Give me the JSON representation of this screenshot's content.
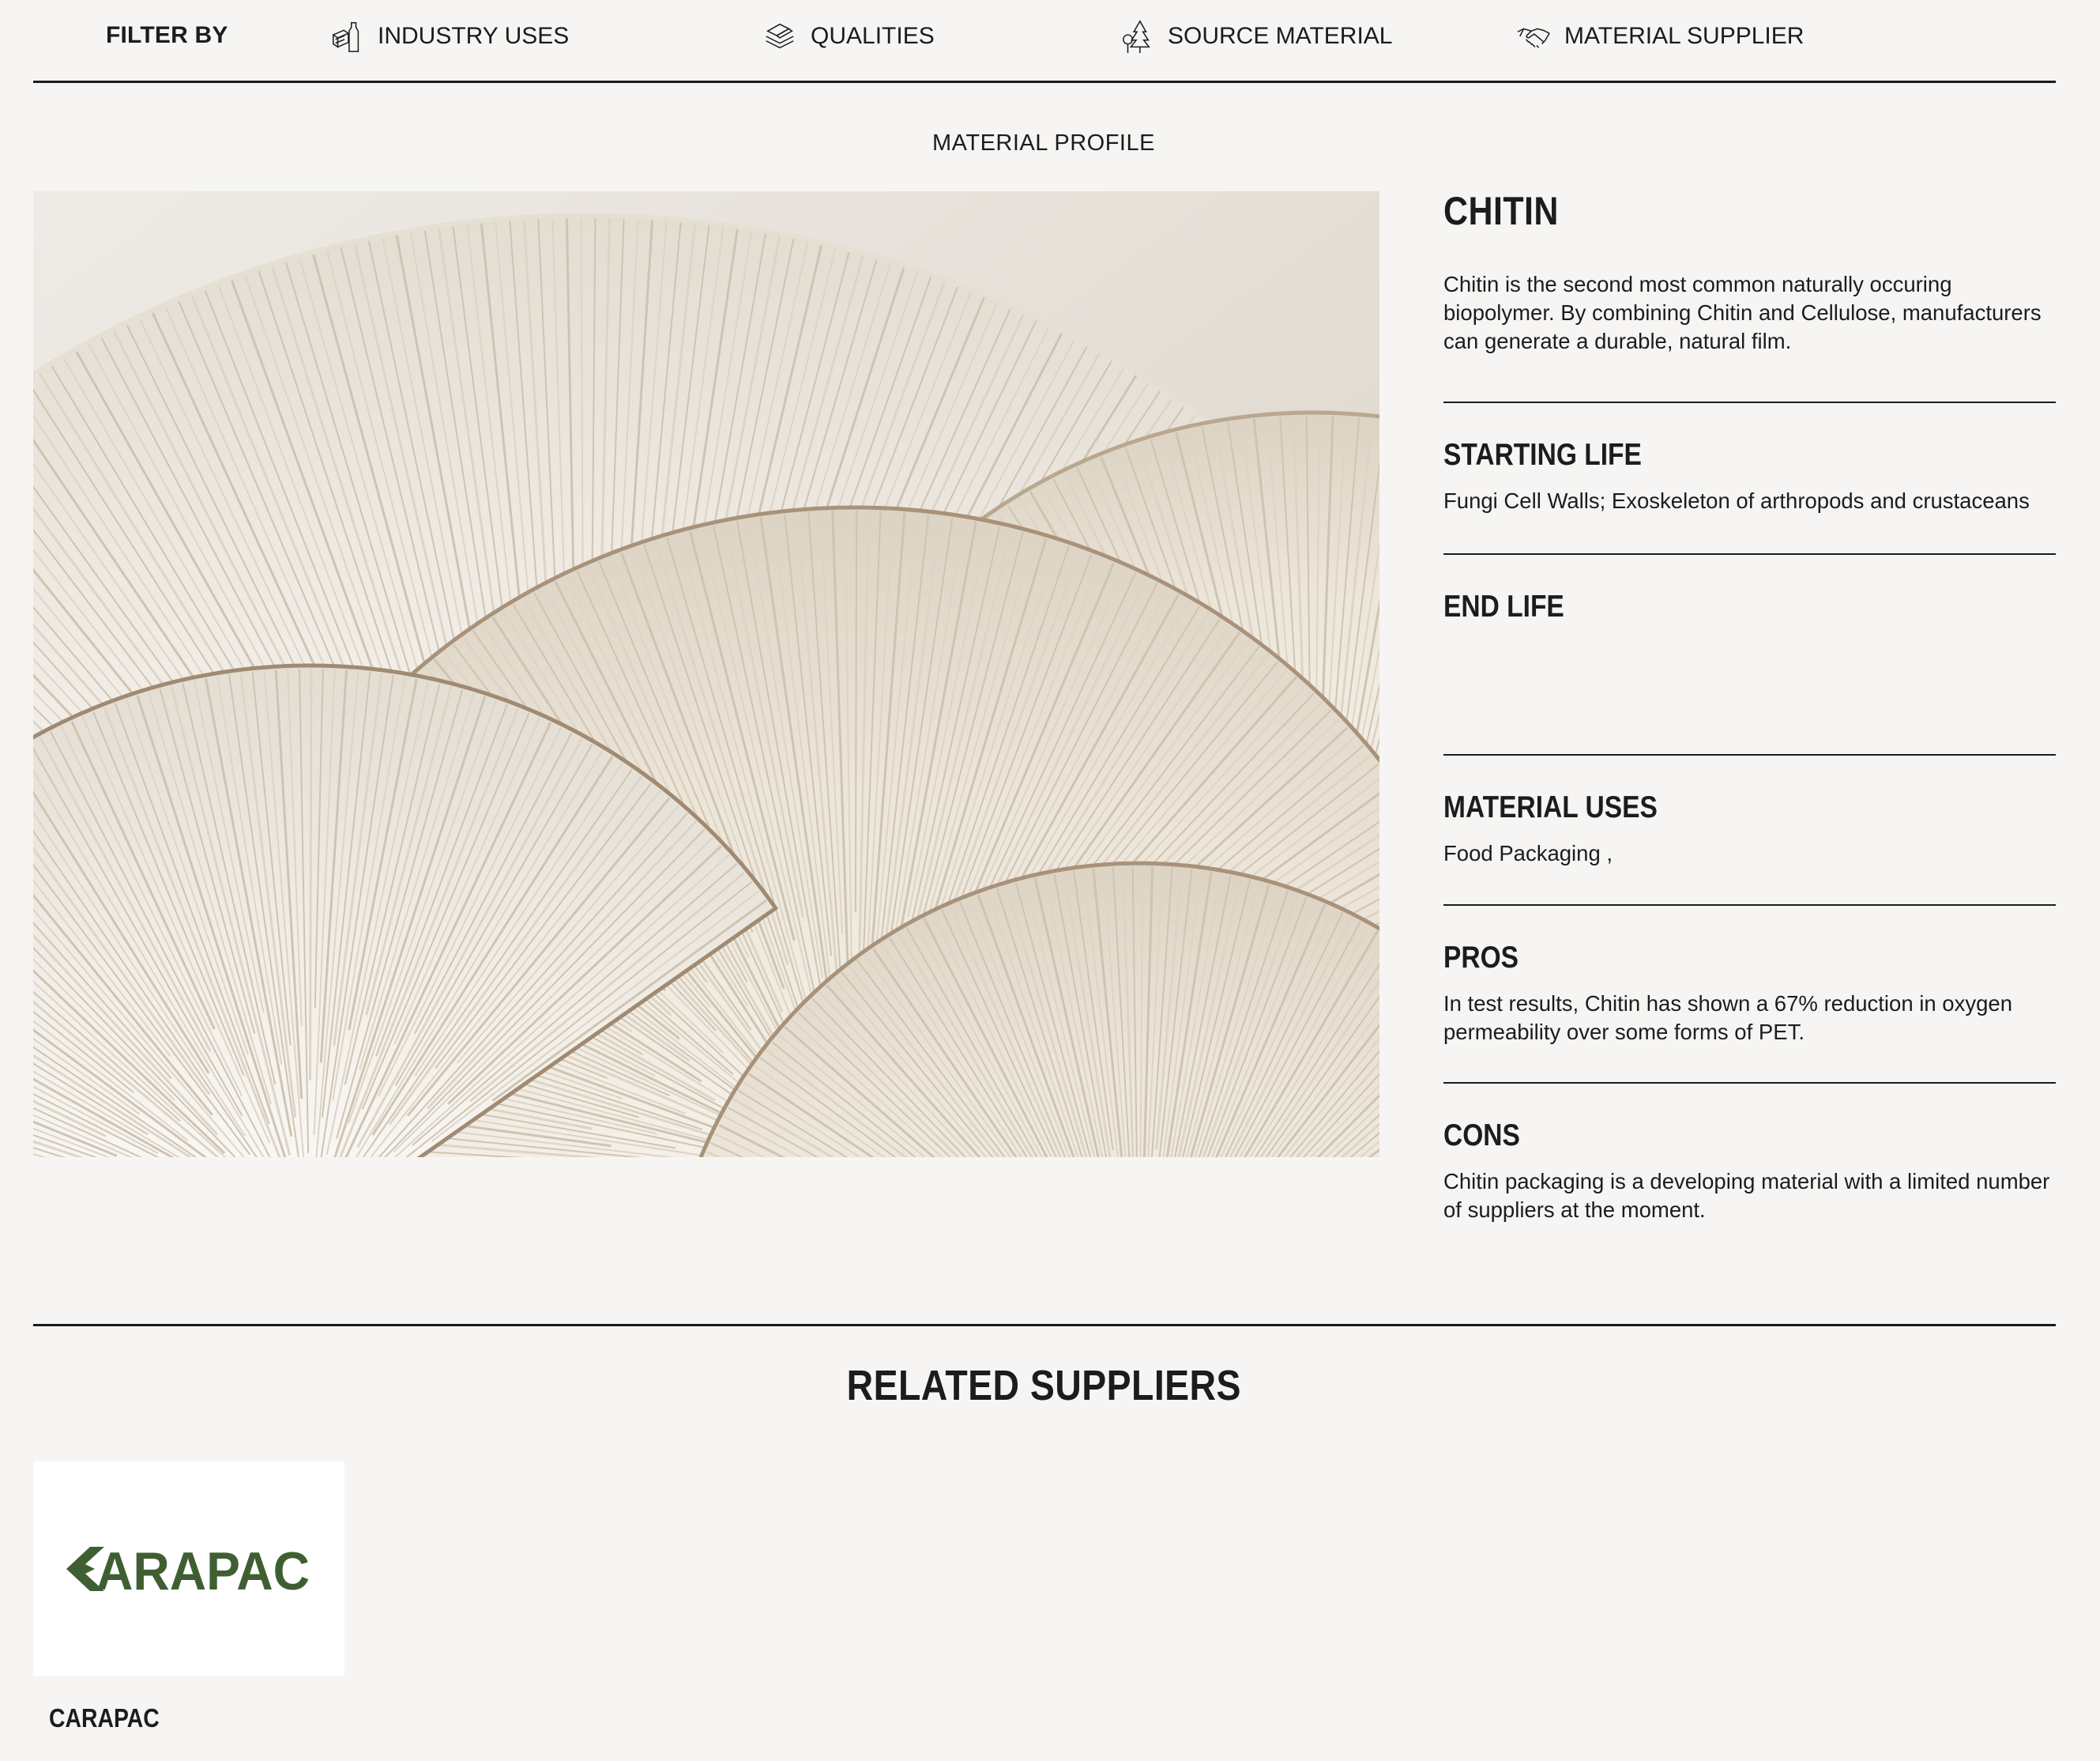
{
  "filter_bar": {
    "label": "FILTER BY",
    "items": [
      {
        "label": "INDUSTRY USES",
        "icon": "bottles-icon"
      },
      {
        "label": "QUALITIES",
        "icon": "layers-icon"
      },
      {
        "label": "SOURCE MATERIAL",
        "icon": "trees-icon"
      },
      {
        "label": "MATERIAL SUPPLIER",
        "icon": "handshake-icon"
      }
    ]
  },
  "section_label": "MATERIAL PROFILE",
  "material": {
    "title": "CHITIN",
    "description": "Chitin is the second most common naturally occuring biopolymer. By combining Chitin and Cellulose, manufacturers can generate a durable, natural film.",
    "starting_life": {
      "heading": "STARTING LIFE",
      "text": "Fungi Cell Walls; Exoskeleton of arthropods and crustaceans"
    },
    "end_life": {
      "heading": "END LIFE",
      "text": ""
    },
    "material_uses": {
      "heading": "MATERIAL USES",
      "text": "Food Packaging ,"
    },
    "pros": {
      "heading": "PROS",
      "text": "In test results, Chitin has shown a 67% reduction in oxygen permeability over some forms of PET."
    },
    "cons": {
      "heading": "CONS",
      "text": "Chitin packaging is a developing material with a limited number of suppliers at the moment."
    }
  },
  "related": {
    "title": "RELATED SUPPLIERS",
    "suppliers": [
      {
        "name": "CARAPAC",
        "logo_text": "ARAPAC",
        "logo_color": "#3f5f32"
      }
    ]
  },
  "colors": {
    "background": "#f6f5f3",
    "text": "#1c1c1c",
    "logo_green": "#3f5f32"
  }
}
